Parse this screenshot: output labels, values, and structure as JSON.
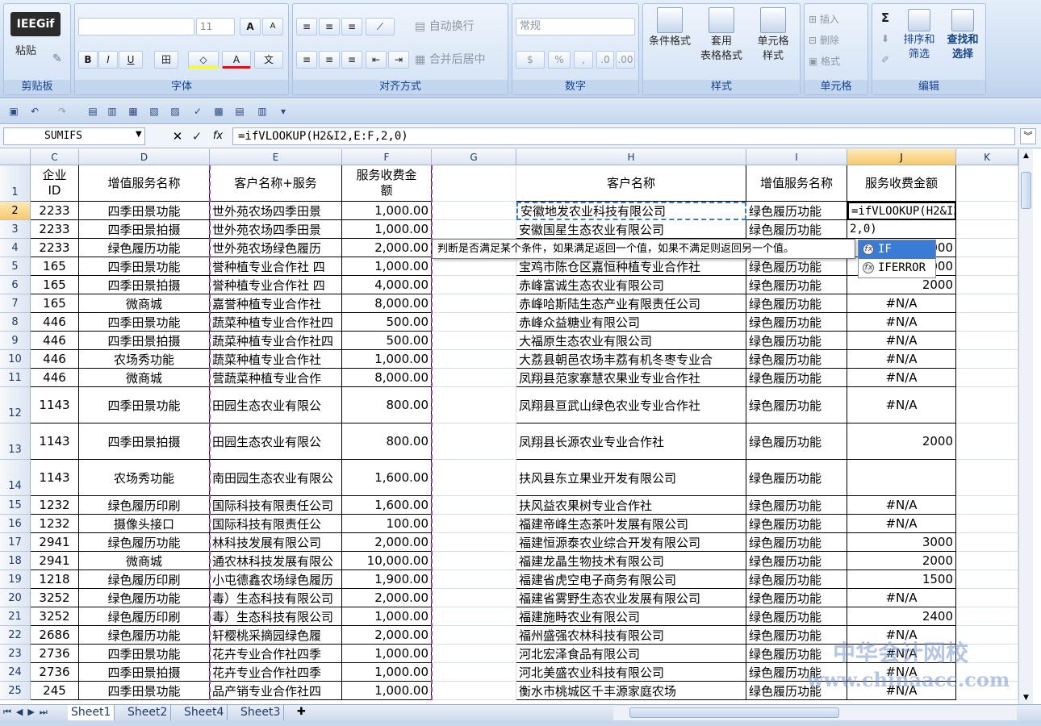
{
  "ribbon": {
    "clipboard": {
      "paste": "粘贴",
      "label": "剪贴板"
    },
    "font": {
      "name": "",
      "size": "11",
      "grow": "A",
      "shrink": "A",
      "bold": "B",
      "italic": "I",
      "underline": "U",
      "border": "田",
      "fill": "◇",
      "fontcolor": "A",
      "phonetic": "文",
      "label": "字体"
    },
    "alignment": {
      "wrap": "自动换行",
      "merge": "合并后居中",
      "label": "对齐方式"
    },
    "number": {
      "format": "常规",
      "percent": "%",
      "comma": ",",
      "label": "数字"
    },
    "styles": {
      "conditional": "条件格式",
      "table1": "套用",
      "table2": "表格格式",
      "cell1": "单元格",
      "cell2": "样式",
      "label": "样式"
    },
    "cells": {
      "insert": "插入",
      "delete": "删除",
      "format": "格式",
      "label": "单元格"
    },
    "editing": {
      "sum": "Σ",
      "sort1": "排序和",
      "sort2": "筛选",
      "find1": "查找和",
      "find2": "选择",
      "label": "编辑"
    },
    "logo": "IEEGif"
  },
  "formula_bar": {
    "name_box": "SUMIFS",
    "cancel": "✕",
    "enter": "✓",
    "fx": "fx",
    "formula": "=ifVLOOKUP(H2&I2,E:F,2,0)"
  },
  "columns": [
    "C",
    "D",
    "E",
    "F",
    "G",
    "H",
    "I",
    "J",
    "K"
  ],
  "header_row": {
    "C": "企业\nID",
    "D": "增值服务名称",
    "E": "客户名称+服务",
    "F": "服务收费金\n额",
    "H": "客户名称",
    "I": "增值服务名称",
    "J": "服务收费金额"
  },
  "rows": [
    {
      "n": "2",
      "C": "2233",
      "D": "四季田景功能",
      "E": "世外苑农场四季田景",
      "F": "1,000.00",
      "H": "安徽地发农业科技有限公司",
      "I": "绿色履历功能",
      "J": "=ifVLOOKUP(H2&I2,E:F,"
    },
    {
      "n": "3",
      "C": "2233",
      "D": "四季田景拍摄",
      "E": "世外苑农场四季田景",
      "F": "1,000.00",
      "H": "安徽国星生态农业有限公司",
      "I": "绿色履历功能",
      "J": "2,0)"
    },
    {
      "n": "4",
      "C": "2233",
      "D": "绿色履历功能",
      "E": "世外苑农场绿色履历",
      "F": "2,000.00",
      "H": "",
      "I": "绿色履历功能",
      "J": "2000"
    },
    {
      "n": "5",
      "C": "165",
      "D": "四季田景功能",
      "E": "誉种植专业合作社 四",
      "F": "1,000.00",
      "H": "宝鸡市陈仓区嘉恒种植专业合作社",
      "I": "绿色履历功能",
      "J": "2000"
    },
    {
      "n": "6",
      "C": "165",
      "D": "四季田景拍摄",
      "E": "誉种植专业合作社 四",
      "F": "4,000.00",
      "H": "赤峰富诚生态农业有限公司",
      "I": "绿色履历功能",
      "J": "2000"
    },
    {
      "n": "7",
      "C": "165",
      "D": "微商城",
      "E": "嘉誉种植专业合作社",
      "F": "8,000.00",
      "H": "赤峰哈斯陆生态产业有限责任公司",
      "I": "绿色履历功能",
      "J": "#N/A"
    },
    {
      "n": "8",
      "C": "446",
      "D": "四季田景功能",
      "E": "蔬菜种植专业合作社四",
      "F": "500.00",
      "H": "赤峰众益糖业有限公司",
      "I": "绿色履历功能",
      "J": "#N/A"
    },
    {
      "n": "9",
      "C": "446",
      "D": "四季田景拍摄",
      "E": "蔬菜种植专业合作社四",
      "F": "500.00",
      "H": "大福原生态农业有限公司",
      "I": "绿色履历功能",
      "J": "#N/A"
    },
    {
      "n": "10",
      "C": "446",
      "D": "农场秀功能",
      "E": "蔬菜种植专业合作社",
      "F": "1,000.00",
      "H": "大荔县朝邑农场丰荔有机冬枣专业合",
      "I": "绿色履历功能",
      "J": "#N/A"
    },
    {
      "n": "11",
      "C": "446",
      "D": "微商城",
      "E": "营蔬菜种植专业合作",
      "F": "8,000.00",
      "H": "凤翔县范家寨慧农果业专业合作社",
      "I": "绿色履历功能",
      "J": "#N/A"
    },
    {
      "n": "12",
      "C": "1143",
      "D": "四季田景功能",
      "E": "田园生态农业有限公",
      "F": "800.00",
      "H": "凤翔县亘武山绿色农业专业合作社",
      "I": "绿色履历功能",
      "J": "#N/A"
    },
    {
      "n": "13",
      "C": "1143",
      "D": "四季田景拍摄",
      "E": "田园生态农业有限公",
      "F": "800.00",
      "H": "凤翔县长源农业专业合作社",
      "I": "绿色履历功能",
      "J": "2000"
    },
    {
      "n": "14",
      "C": "1143",
      "D": "农场秀功能",
      "E": "南田园生态农业有限公",
      "F": "1,600.00",
      "H": "扶风县东立果业开发有限公司",
      "I": "绿色履历功能",
      "J": ""
    },
    {
      "n": "15",
      "C": "1232",
      "D": "绿色履历印刷",
      "E": "国际科技有限责任公司",
      "F": "1,600.00",
      "H": "扶风益农果树专业合作社",
      "I": "绿色履历功能",
      "J": "#N/A"
    },
    {
      "n": "16",
      "C": "1232",
      "D": "摄像头接口",
      "E": "国际科技有限责任公",
      "F": "100.00",
      "H": "福建帝峰生态茶叶发展有限公司",
      "I": "绿色履历功能",
      "J": "#N/A"
    },
    {
      "n": "17",
      "C": "2941",
      "D": "绿色履历功能",
      "E": "林科技发展有限公司",
      "F": "2,000.00",
      "H": "福建恒源泰农业综合开发有限公司",
      "I": "绿色履历功能",
      "J": "3000"
    },
    {
      "n": "18",
      "C": "2941",
      "D": "微商城",
      "E": "通农林科技发展有限公",
      "F": "10,000.00",
      "H": "福建龙晶生物技术有限公司",
      "I": "绿色履历功能",
      "J": "2000"
    },
    {
      "n": "19",
      "C": "1218",
      "D": "绿色履历印刷",
      "E": "小屯德鑫农场绿色履历",
      "F": "1,900.00",
      "H": "福建省虎空电子商务有限公司",
      "I": "绿色履历功能",
      "J": "1500"
    },
    {
      "n": "20",
      "C": "3252",
      "D": "绿色履历功能",
      "E": "毒）生态科技有限公司",
      "F": "2,000.00",
      "H": "福建省雾野生态农业发展有限公司",
      "I": "绿色履历功能",
      "J": "#N/A"
    },
    {
      "n": "21",
      "C": "3252",
      "D": "绿色履历印刷",
      "E": "毒）生态科技有限公司",
      "F": "1,000.00",
      "H": "福建施畤农业有限公司",
      "I": "绿色履历功能",
      "J": "2400"
    },
    {
      "n": "22",
      "C": "2686",
      "D": "绿色履历功能",
      "E": "轩樱桃采摘园绿色履",
      "F": "2,000.00",
      "H": "福州盛强农林科技有限公司",
      "I": "绿色履历功能",
      "J": "#N/A"
    },
    {
      "n": "23",
      "C": "2736",
      "D": "四季田景功能",
      "E": "花卉专业合作社四季",
      "F": "1,000.00",
      "H": "河北宏泽食品有限公司",
      "I": "绿色履历功能",
      "J": "#N/A"
    },
    {
      "n": "24",
      "C": "2736",
      "D": "四季田景拍摄",
      "E": "花卉专业合作社四季",
      "F": "1,000.00",
      "H": "河北美盛农业科技有限公司",
      "I": "绿色履历功能",
      "J": "#N/A"
    },
    {
      "n": "25",
      "C": "245",
      "D": "四季田景功能",
      "E": "品产销专业合作社四",
      "F": "1,000.00",
      "H": "衡水市桃城区千丰源家庭农场",
      "I": "绿色履历功能",
      "J": "#N/A"
    }
  ],
  "tooltip": "判断是否满足某个条件，如果满足返回一个值，如果不满足则返回另一个值。",
  "autocomplete": [
    "IF",
    "IFERROR"
  ],
  "sheets": [
    "Sheet1",
    "Sheet2",
    "Sheet4",
    "Sheet3"
  ],
  "watermark": {
    "cn": "中华会计网校",
    "url": "www.chinaacc.com"
  }
}
